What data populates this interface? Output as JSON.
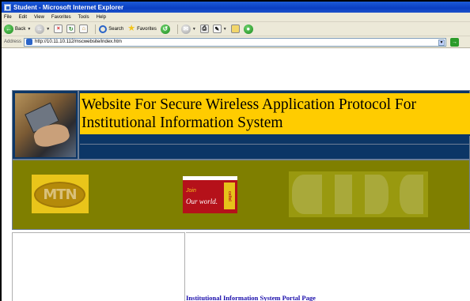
{
  "window": {
    "title": "Student - Microsoft Internet Explorer"
  },
  "menu": {
    "items": [
      "File",
      "Edit",
      "View",
      "Favorites",
      "Tools",
      "Help"
    ]
  },
  "toolbar": {
    "back_label": "Back",
    "search_label": "Search",
    "favorites_label": "Favorites"
  },
  "address": {
    "label": "Address",
    "url": "http://10.11.10.112/mscwebsite/index.htm"
  },
  "page": {
    "header_title": "Website For Secure Wireless Application Protocol For Institutional Information System",
    "mtn_logo_text": "MTN",
    "celtel_join_text": "Join",
    "celtel_world_text": "Our world.",
    "celtel_brand_text": "celtel",
    "portal_link_text": "Institutional Information System Portal Page"
  },
  "colors": {
    "header_bg": "#0c3666",
    "title_box_bg": "#ffcc00",
    "logo_band_bg": "#7f7f00",
    "link_color": "#1a0dab"
  }
}
